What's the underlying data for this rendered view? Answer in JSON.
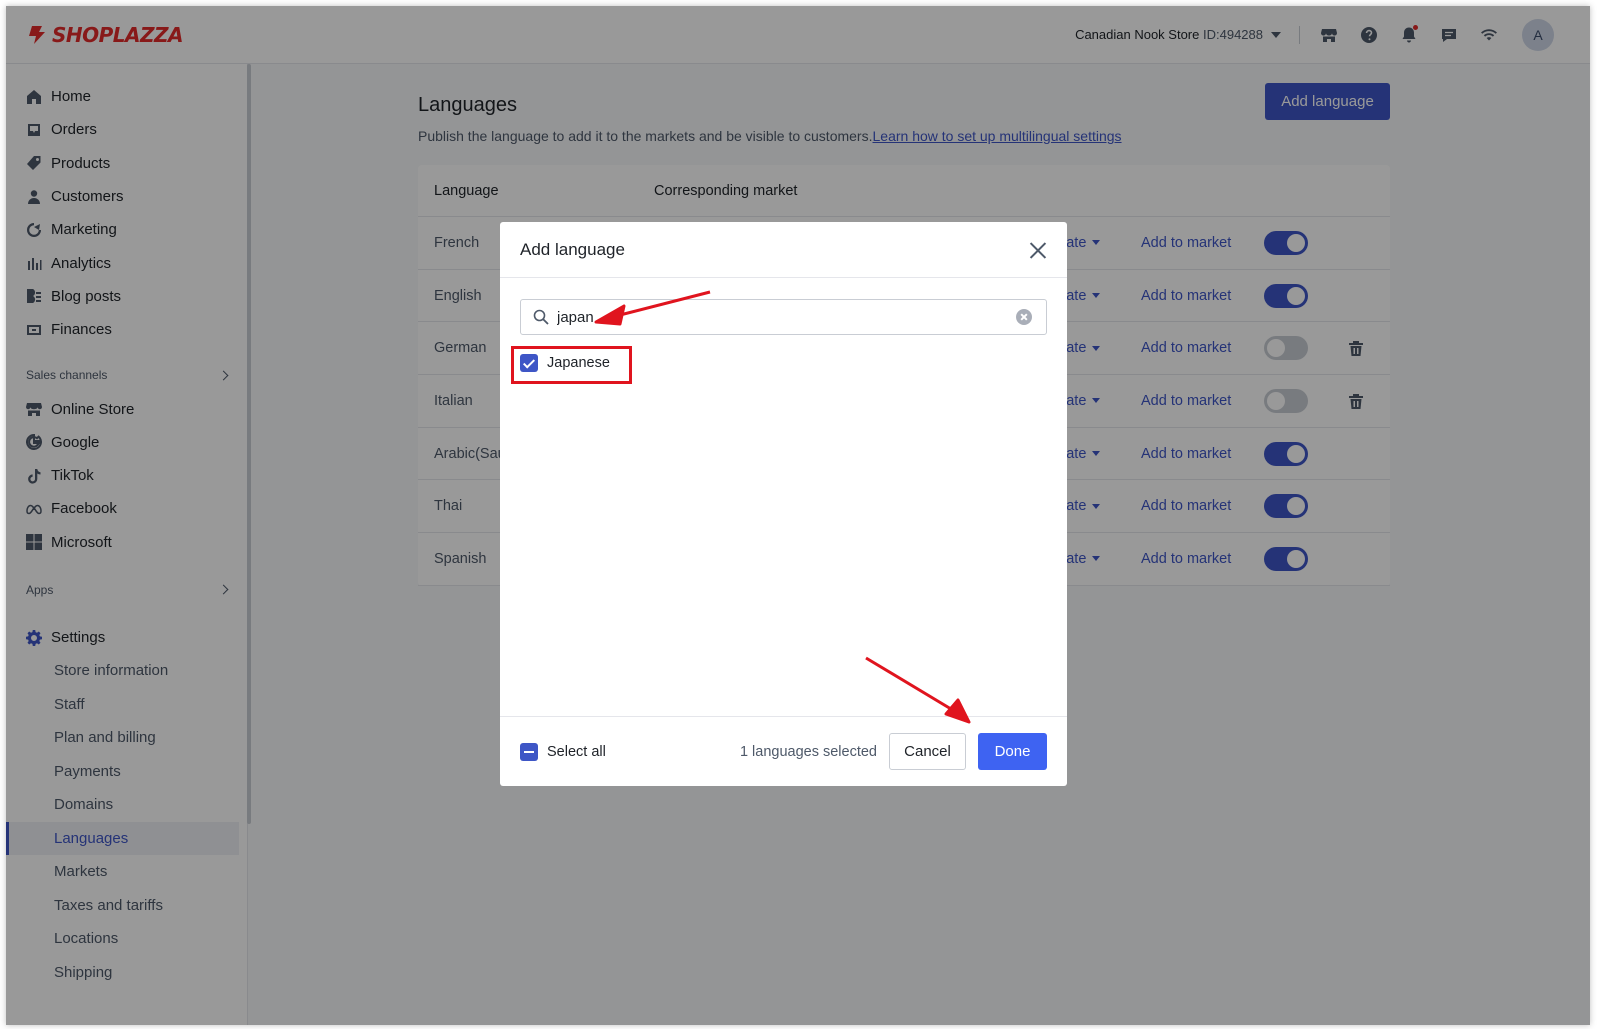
{
  "brand": {
    "name": "SHOPLAZZA",
    "color": "#e32b2b"
  },
  "header": {
    "store_name": "Canadian Nook Store",
    "store_id": "ID:494288",
    "icons": [
      "store-icon",
      "help-icon",
      "bell-icon",
      "chat-icon",
      "wifi-icon"
    ],
    "avatar_letter": "A"
  },
  "sidebar": {
    "items": [
      {
        "label": "Home",
        "icon": "home-icon"
      },
      {
        "label": "Orders",
        "icon": "orders-icon"
      },
      {
        "label": "Products",
        "icon": "tag-icon"
      },
      {
        "label": "Customers",
        "icon": "user-icon"
      },
      {
        "label": "Marketing",
        "icon": "marketing-icon"
      },
      {
        "label": "Analytics",
        "icon": "bar-chart-icon"
      },
      {
        "label": "Blog posts",
        "icon": "blog-icon"
      },
      {
        "label": "Finances",
        "icon": "finance-icon"
      }
    ],
    "sales_channels_label": "Sales channels",
    "channels": [
      {
        "label": "Online Store",
        "icon": "store-icon"
      },
      {
        "label": "Google",
        "icon": "google-icon"
      },
      {
        "label": "TikTok",
        "icon": "tiktok-icon"
      },
      {
        "label": "Facebook",
        "icon": "meta-icon"
      },
      {
        "label": "Microsoft",
        "icon": "microsoft-icon"
      }
    ],
    "apps_label": "Apps",
    "settings_label": "Settings",
    "settings_items": [
      "Store information",
      "Staff",
      "Plan and billing",
      "Payments",
      "Domains",
      "Languages",
      "Markets",
      "Taxes and tariffs",
      "Locations",
      "Shipping"
    ],
    "active_item": "Languages"
  },
  "page": {
    "title": "Languages",
    "subtitle": "Publish the language to add it to the markets and be visible to customers.",
    "help_link": "Learn how to set up multilingual settings",
    "add_button": "Add language",
    "columns": [
      "Language",
      "Corresponding market"
    ],
    "translate_label": "late",
    "add_to_market_label": "Add to market",
    "rows": [
      {
        "language": "French",
        "published": true,
        "deletable": false
      },
      {
        "language": "English",
        "published": true,
        "deletable": false
      },
      {
        "language": "German",
        "published": false,
        "deletable": true
      },
      {
        "language": "Italian",
        "published": false,
        "deletable": true
      },
      {
        "language": "Arabic(Sau",
        "published": true,
        "deletable": false
      },
      {
        "language": "Thai",
        "published": true,
        "deletable": false
      },
      {
        "language": "Spanish",
        "published": true,
        "deletable": false
      }
    ]
  },
  "modal": {
    "title": "Add language",
    "search_value": "japan",
    "options": [
      {
        "label": "Japanese",
        "checked": true
      }
    ],
    "select_all_label": "Select all",
    "selected_count": "1 languages selected",
    "cancel_label": "Cancel",
    "done_label": "Done"
  },
  "colors": {
    "accent": "#3e56c6",
    "primary_button": "#3e63f2",
    "annotation": "#e0141e"
  }
}
